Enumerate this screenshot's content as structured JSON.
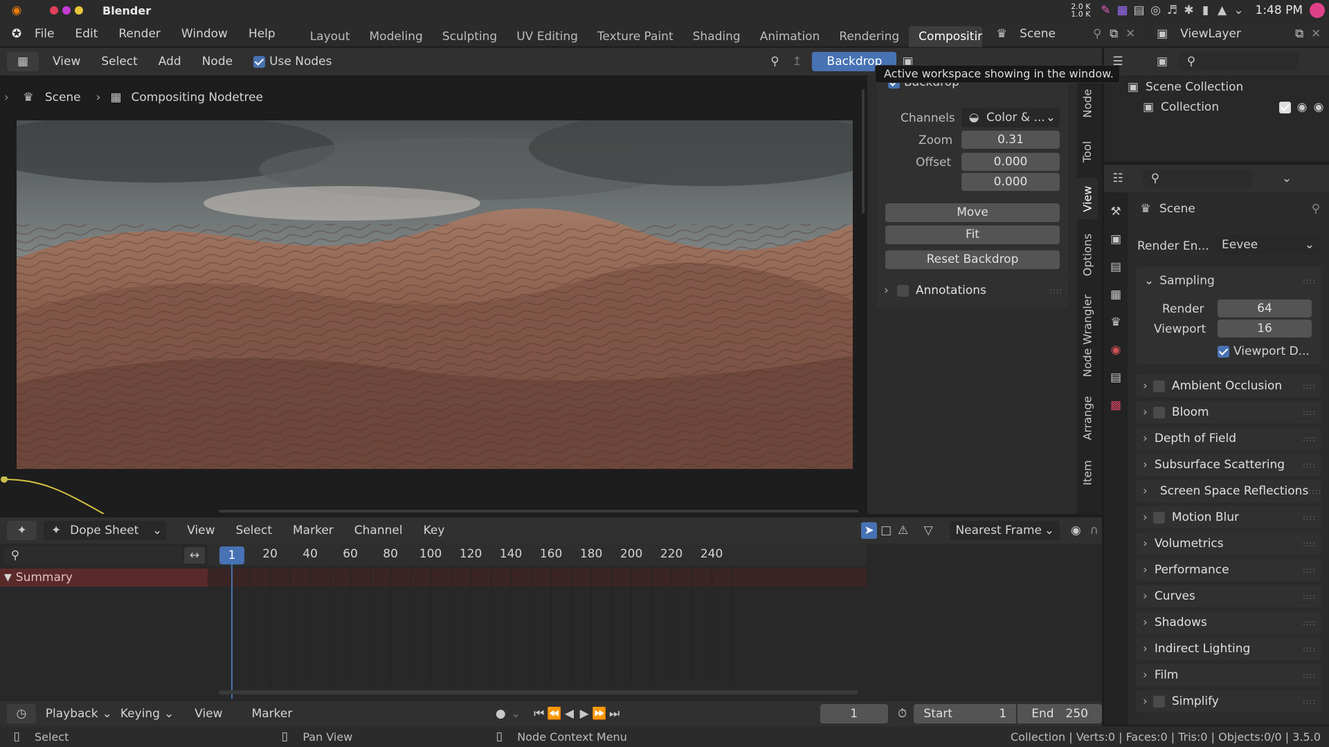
{
  "system_bar": {
    "app_name": "Blender",
    "net_up": "2.0 K",
    "net_down": "1.0 K",
    "time": "1:48 PM"
  },
  "top_menu": {
    "items": [
      "File",
      "Edit",
      "Render",
      "Window",
      "Help"
    ],
    "workspaces": [
      "Layout",
      "Modeling",
      "Sculpting",
      "UV Editing",
      "Texture Paint",
      "Shading",
      "Animation",
      "Rendering",
      "Compositing"
    ],
    "active_workspace": "Compositing",
    "scene": "Scene",
    "view_layer": "ViewLayer"
  },
  "tooltip": "Active workspace showing in the window.",
  "node_editor": {
    "menus": [
      "View",
      "Select",
      "Add",
      "Node"
    ],
    "use_nodes_label": "Use Nodes",
    "backdrop_button": "Backdrop",
    "breadcrumb": [
      "Scene",
      "Compositing Nodetree"
    ]
  },
  "sidebar": {
    "tabs": [
      "Node",
      "Tool",
      "View",
      "Options",
      "Node Wrangler",
      "Arrange",
      "Item"
    ],
    "backdrop_header": "Backdrop",
    "channels_label": "Channels",
    "channels_value": "Color & ...",
    "zoom_label": "Zoom",
    "zoom_value": "0.31",
    "offset_label": "Offset",
    "offset_x": "0.000",
    "offset_y": "0.000",
    "move_button": "Move",
    "fit_button": "Fit",
    "reset_button": "Reset Backdrop",
    "annotations_label": "Annotations"
  },
  "outliner": {
    "scene_collection": "Scene Collection",
    "collection": "Collection"
  },
  "properties": {
    "scene_label": "Scene",
    "render_engine_label": "Render En...",
    "render_engine_value": "Eevee",
    "sampling_label": "Sampling",
    "render_label": "Render",
    "render_value": "64",
    "viewport_label": "Viewport",
    "viewport_value": "16",
    "viewport_denoise": "Viewport D...",
    "panels": [
      {
        "label": "Ambient Occlusion",
        "checkbox": true
      },
      {
        "label": "Bloom",
        "checkbox": true
      },
      {
        "label": "Depth of Field",
        "checkbox": false
      },
      {
        "label": "Subsurface Scattering",
        "checkbox": false
      },
      {
        "label": "Screen Space Reflections",
        "checkbox": true
      },
      {
        "label": "Motion Blur",
        "checkbox": true
      },
      {
        "label": "Volumetrics",
        "checkbox": false
      },
      {
        "label": "Performance",
        "checkbox": false
      },
      {
        "label": "Curves",
        "checkbox": false
      },
      {
        "label": "Shadows",
        "checkbox": false
      },
      {
        "label": "Indirect Lighting",
        "checkbox": false
      },
      {
        "label": "Film",
        "checkbox": false
      },
      {
        "label": "Simplify",
        "checkbox": true
      }
    ]
  },
  "dopesheet": {
    "mode": "Dope Sheet",
    "menus": [
      "View",
      "Select",
      "Marker",
      "Channel",
      "Key"
    ],
    "snap": "Nearest Frame",
    "current_frame": "1",
    "ticks": [
      "20",
      "40",
      "60",
      "80",
      "100",
      "120",
      "140",
      "160",
      "180",
      "200",
      "220",
      "240"
    ],
    "summary": "Summary"
  },
  "timeline": {
    "menus": [
      "Playback",
      "Keying",
      "View",
      "Marker"
    ],
    "frame": "1",
    "start_label": "Start",
    "start_value": "1",
    "end_label": "End",
    "end_value": "250"
  },
  "status_bar": {
    "select": "Select",
    "pan": "Pan View",
    "context": "Node Context Menu",
    "stats": "Collection | Verts:0 | Faces:0 | Tris:0 | Objects:0/0 | 3.5.0"
  },
  "colors": {
    "accent": "#4772b3",
    "summary_row": "#5a2a2a",
    "playhead": "#4772b3"
  }
}
